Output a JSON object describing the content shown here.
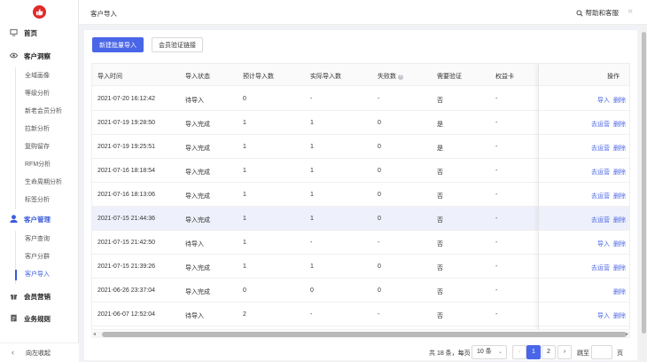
{
  "sidebar": {
    "sections": [
      {
        "label": "首页",
        "icon": "monitor-icon"
      },
      {
        "label": "客户洞察",
        "icon": "eye-icon",
        "items": [
          "全域画像",
          "等级分析",
          "新老会员分析",
          "拉新分析",
          "复购留存",
          "RFM分析",
          "生命周期分析",
          "标签分析"
        ]
      },
      {
        "label": "客户管理",
        "icon": "user-icon",
        "items": [
          "客户查询",
          "客户分群",
          "客户导入"
        ],
        "active_item": "客户导入"
      },
      {
        "label": "会员营销",
        "icon": "gift-icon"
      },
      {
        "label": "业务规则",
        "icon": "document-icon"
      }
    ],
    "collapse_label": "向左收起"
  },
  "header": {
    "title": "客户导入",
    "help_label": "帮助和客服"
  },
  "toolbar": {
    "new_import_label": "新建批量导入",
    "member_link_label": "会员验证链接"
  },
  "table": {
    "columns": [
      "导入时间",
      "导入状态",
      "预计导入数",
      "实际导入数",
      "失败数",
      "需要验证",
      "权益卡",
      "操作"
    ],
    "action_labels": {
      "operate": "去运营",
      "import": "导入",
      "delete": "删除"
    },
    "rows": [
      {
        "time": "2021-07-20 16:12:42",
        "status": "待导入",
        "expected": "0",
        "actual": "-",
        "failed": "-",
        "verify": "否",
        "card": "-",
        "actions": [
          "import",
          "delete"
        ]
      },
      {
        "time": "2021-07-19 19:28:50",
        "status": "导入完成",
        "expected": "1",
        "actual": "1",
        "failed": "0",
        "verify": "是",
        "card": "-",
        "actions": [
          "operate",
          "delete"
        ]
      },
      {
        "time": "2021-07-19 19:25:51",
        "status": "导入完成",
        "expected": "1",
        "actual": "1",
        "failed": "0",
        "verify": "是",
        "card": "-",
        "actions": [
          "operate",
          "delete"
        ]
      },
      {
        "time": "2021-07-16 18:18:54",
        "status": "导入完成",
        "expected": "1",
        "actual": "1",
        "failed": "0",
        "verify": "否",
        "card": "-",
        "actions": [
          "operate",
          "delete"
        ]
      },
      {
        "time": "2021-07-16 18:13:06",
        "status": "导入完成",
        "expected": "1",
        "actual": "1",
        "failed": "0",
        "verify": "否",
        "card": "-",
        "actions": [
          "operate",
          "delete"
        ]
      },
      {
        "time": "2021-07-15 21:44:36",
        "status": "导入完成",
        "expected": "1",
        "actual": "1",
        "failed": "0",
        "verify": "否",
        "card": "-",
        "actions": [
          "operate",
          "delete"
        ],
        "highlight": true
      },
      {
        "time": "2021-07-15 21:42:50",
        "status": "待导入",
        "expected": "1",
        "actual": "-",
        "failed": "-",
        "verify": "否",
        "card": "-",
        "actions": [
          "import",
          "delete"
        ]
      },
      {
        "time": "2021-07-15 21:39:26",
        "status": "导入完成",
        "expected": "1",
        "actual": "1",
        "failed": "0",
        "verify": "否",
        "card": "-",
        "actions": [
          "operate",
          "delete"
        ]
      },
      {
        "time": "2021-06-26 23:37:04",
        "status": "导入完成",
        "expected": "0",
        "actual": "0",
        "failed": "0",
        "verify": "否",
        "card": "-",
        "actions": [
          "delete"
        ]
      },
      {
        "time": "2021-06-07 12:52:04",
        "status": "待导入",
        "expected": "2",
        "actual": "-",
        "failed": "-",
        "verify": "否",
        "card": "-",
        "actions": [
          "import",
          "delete"
        ]
      }
    ]
  },
  "pagination": {
    "total_text": "共 18 条，每页",
    "page_size": "10 条",
    "pages": [
      "1",
      "2"
    ],
    "current": "1",
    "jump_label": "跳至",
    "page_suffix": "页"
  },
  "colors": {
    "accent": "#4a66e8",
    "brand": "#e02a2a"
  }
}
